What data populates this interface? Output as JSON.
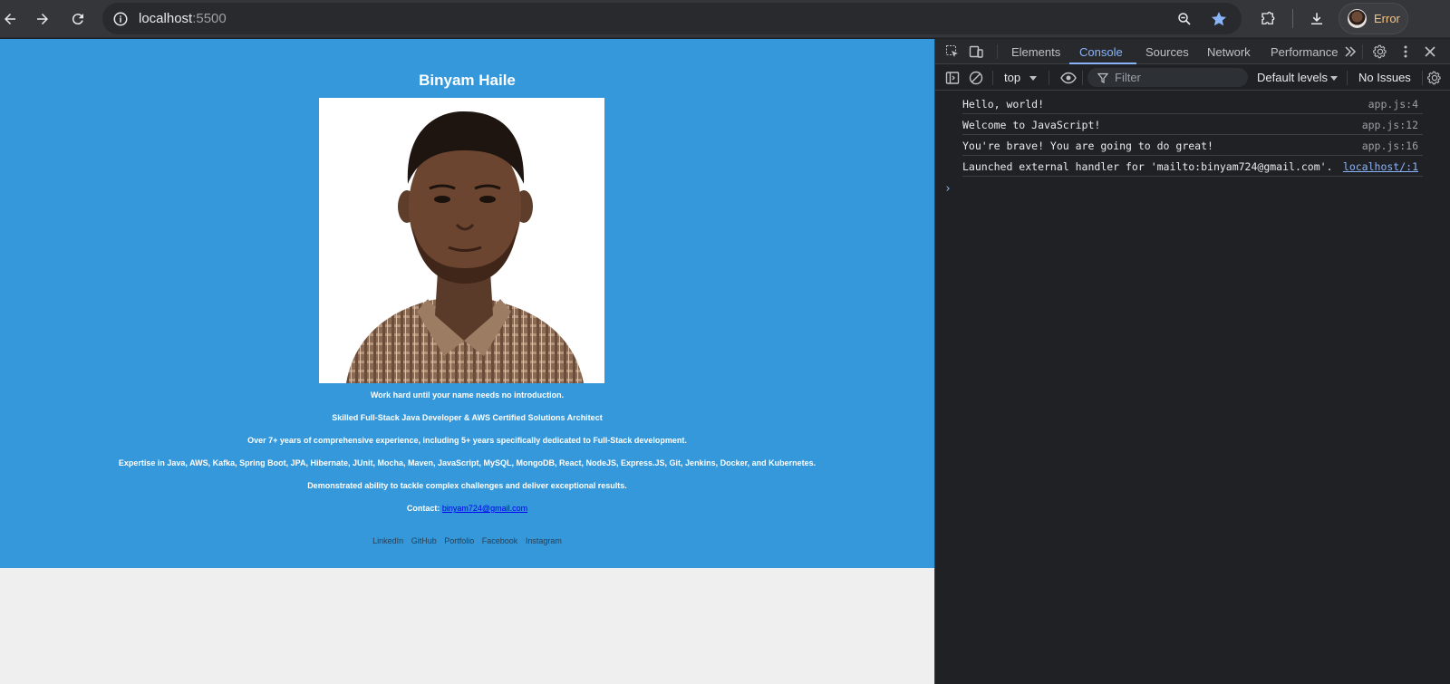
{
  "browser": {
    "url_host": "localhost",
    "url_port": ":5500",
    "profile_label": "Error"
  },
  "page": {
    "name": "Binyam Haile",
    "photo_alt": "Binyam Haile",
    "motto": "Work hard until your name needs no introduction.",
    "role": "Skilled Full-Stack Java Developer & AWS Certified Solutions Architect",
    "experience": "Over 7+ years of comprehensive experience, including 5+ years specifically dedicated to Full-Stack development.",
    "expertise": "Expertise in Java, AWS, Kafka, Spring Boot, JPA, Hibernate, JUnit, Mocha, Maven, JavaScript, MySQL, MongoDB, React, NodeJS, Express.JS, Git, Jenkins, Docker, and Kubernetes.",
    "ability": "Demonstrated ability to tackle complex challenges and deliver exceptional results.",
    "contact_label": "Contact:",
    "contact_email": "binyam724@gmail.com",
    "social_links": [
      "LinkedIn",
      "GitHub",
      "Portfolio",
      "Facebook",
      "Instagram"
    ]
  },
  "devtools": {
    "tabs": [
      "Elements",
      "Console",
      "Sources",
      "Network",
      "Performance"
    ],
    "active_tab": "Console",
    "context": "top",
    "filter_placeholder": "Filter",
    "levels": "Default levels",
    "issues": "No Issues",
    "console_logs": [
      {
        "message": "Hello, world!",
        "source": "app.js:4"
      },
      {
        "message": "Welcome to JavaScript!",
        "source": "app.js:12"
      },
      {
        "message": "You're brave! You are going to do great!",
        "source": "app.js:16"
      },
      {
        "message": "Launched external handler for 'mailto:binyam724@gmail.com'.",
        "source": "localhost/:1"
      }
    ],
    "prompt": "›"
  },
  "colors": {
    "page_bg": "#3498db",
    "link": "#0000ee",
    "devtools_accent": "#8ab4f8"
  }
}
